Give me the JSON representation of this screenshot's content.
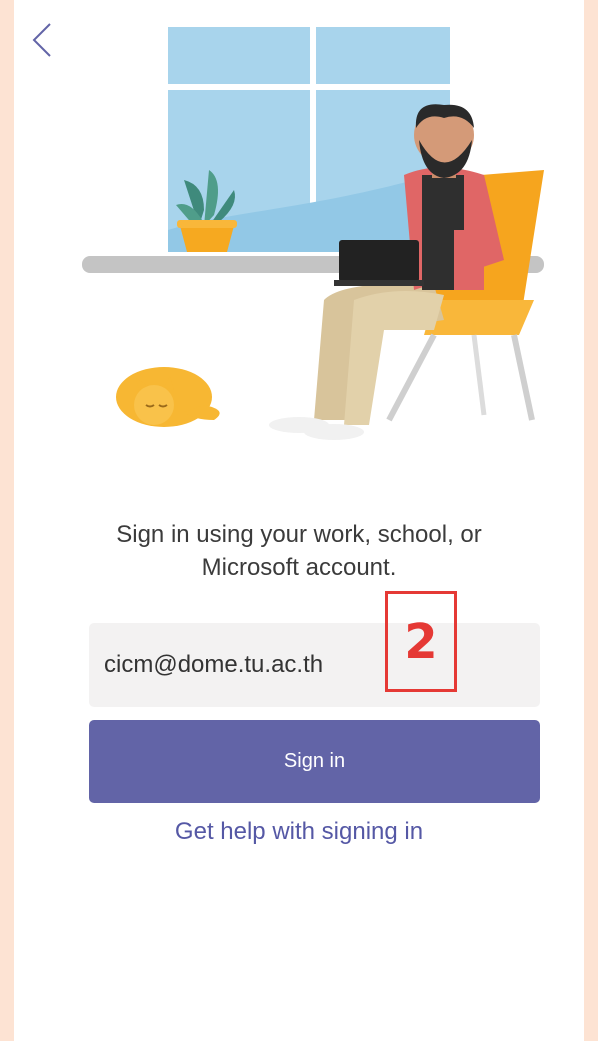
{
  "nav": {
    "back_icon": "chevron-left-icon"
  },
  "signin": {
    "prompt": "Sign in using your work, school, or Microsoft account.",
    "email_value": "cicm@dome.tu.ac.th",
    "signin_label": "Sign in",
    "help_link": "Get help with signing in"
  },
  "annotation": {
    "label": "2"
  },
  "colors": {
    "accent": "#6264a7",
    "link": "#5558a5",
    "annotation": "#e53935",
    "outer_background": "#fde3d3"
  }
}
